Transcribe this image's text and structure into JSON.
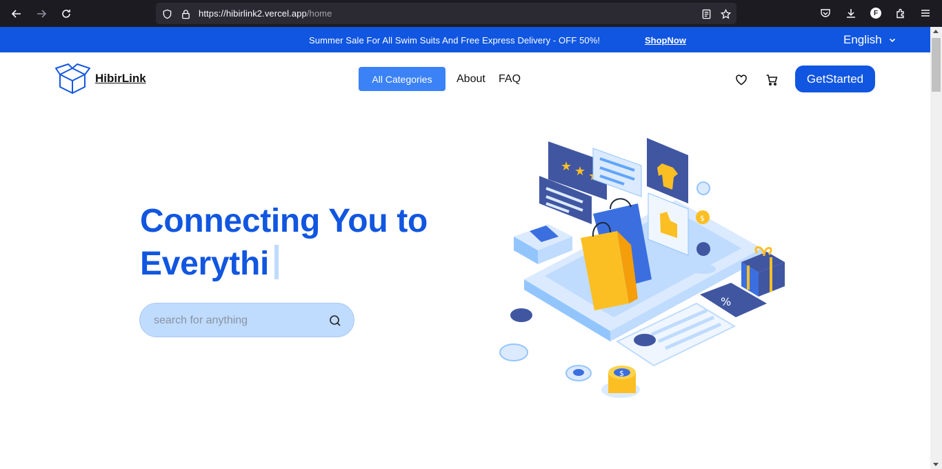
{
  "browser": {
    "url_main": "https://hibirlink2.vercel.app",
    "url_path": "/home",
    "profile_initial": "F"
  },
  "promo": {
    "text": "Summer Sale For All Swim Suits And Free Express Delivery - OFF 50%!",
    "link": "ShopNow",
    "language": "English"
  },
  "header": {
    "logo_text": "HibirLink",
    "categories_label": "All Categories",
    "nav": [
      "About",
      "FAQ"
    ],
    "cta": "GetStarted"
  },
  "hero": {
    "title_line1": "Connecting You to",
    "title_line2": "Everythi",
    "search_placeholder": "search for anything"
  },
  "colors": {
    "brand": "#1156e0",
    "button": "#3b82f6",
    "search_bg": "#bfdbfe"
  }
}
